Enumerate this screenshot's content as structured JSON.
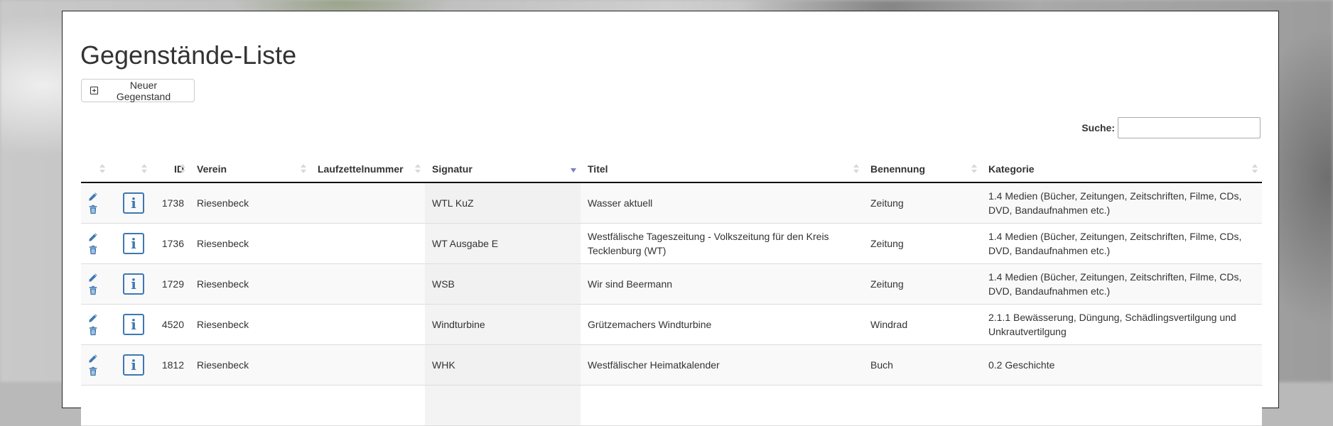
{
  "page": {
    "title": "Gegenstände-Liste"
  },
  "toolbar": {
    "new_item_label": "Neuer Gegenstand"
  },
  "search": {
    "label": "Suche:",
    "value": ""
  },
  "table": {
    "columns": [
      {
        "key": "actions",
        "label": ""
      },
      {
        "key": "info",
        "label": ""
      },
      {
        "key": "id",
        "label": "ID"
      },
      {
        "key": "verein",
        "label": "Verein"
      },
      {
        "key": "laufzettelnummer",
        "label": "Laufzettelnummer"
      },
      {
        "key": "signatur",
        "label": "Signatur",
        "sorted": "desc"
      },
      {
        "key": "titel",
        "label": "Titel"
      },
      {
        "key": "benennung",
        "label": "Benennung"
      },
      {
        "key": "kategorie",
        "label": "Kategorie"
      }
    ],
    "rows": [
      {
        "id": "1738",
        "verein": "Riesenbeck",
        "laufzettelnummer": "",
        "signatur": "WTL KuZ",
        "titel": "Wasser aktuell",
        "benennung": "Zeitung",
        "kategorie": "1.4 Medien (Bücher, Zeitungen, Zeitschriften, Filme, CDs, DVD, Bandaufnahmen etc.)"
      },
      {
        "id": "1736",
        "verein": "Riesenbeck",
        "laufzettelnummer": "",
        "signatur": "WT Ausgabe E",
        "titel": "Westfälische Tageszeitung - Volkszeitung für den Kreis Tecklenburg (WT)",
        "benennung": "Zeitung",
        "kategorie": "1.4 Medien (Bücher, Zeitungen, Zeitschriften, Filme, CDs, DVD, Bandaufnahmen etc.)"
      },
      {
        "id": "1729",
        "verein": "Riesenbeck",
        "laufzettelnummer": "",
        "signatur": "WSB",
        "titel": "Wir sind Beermann",
        "benennung": "Zeitung",
        "kategorie": "1.4 Medien (Bücher, Zeitungen, Zeitschriften, Filme, CDs, DVD, Bandaufnahmen etc.)"
      },
      {
        "id": "4520",
        "verein": "Riesenbeck",
        "laufzettelnummer": "",
        "signatur": "Windturbine",
        "titel": "Grützemachers Windturbine",
        "benennung": "Windrad",
        "kategorie": "2.1.1 Bewässerung, Düngung, Schädlingsvertilgung und Unkrautvertilgung"
      },
      {
        "id": "1812",
        "verein": "Riesenbeck",
        "laufzettelnummer": "",
        "signatur": "WHK",
        "titel": "Westfälischer Heimatkalender",
        "benennung": "Buch",
        "kategorie": "0.2 Geschichte"
      },
      {
        "id": "",
        "verein": "",
        "laufzettelnummer": "",
        "signatur": "",
        "titel": "",
        "benennung": "",
        "kategorie": ""
      }
    ]
  },
  "icons": {
    "edit": "pencil-icon",
    "delete": "trash-icon",
    "info": "info-icon",
    "add": "plus-square-icon"
  },
  "colors": {
    "icon_blue": "#3d78b3",
    "sort_active": "#7a7fc0"
  }
}
